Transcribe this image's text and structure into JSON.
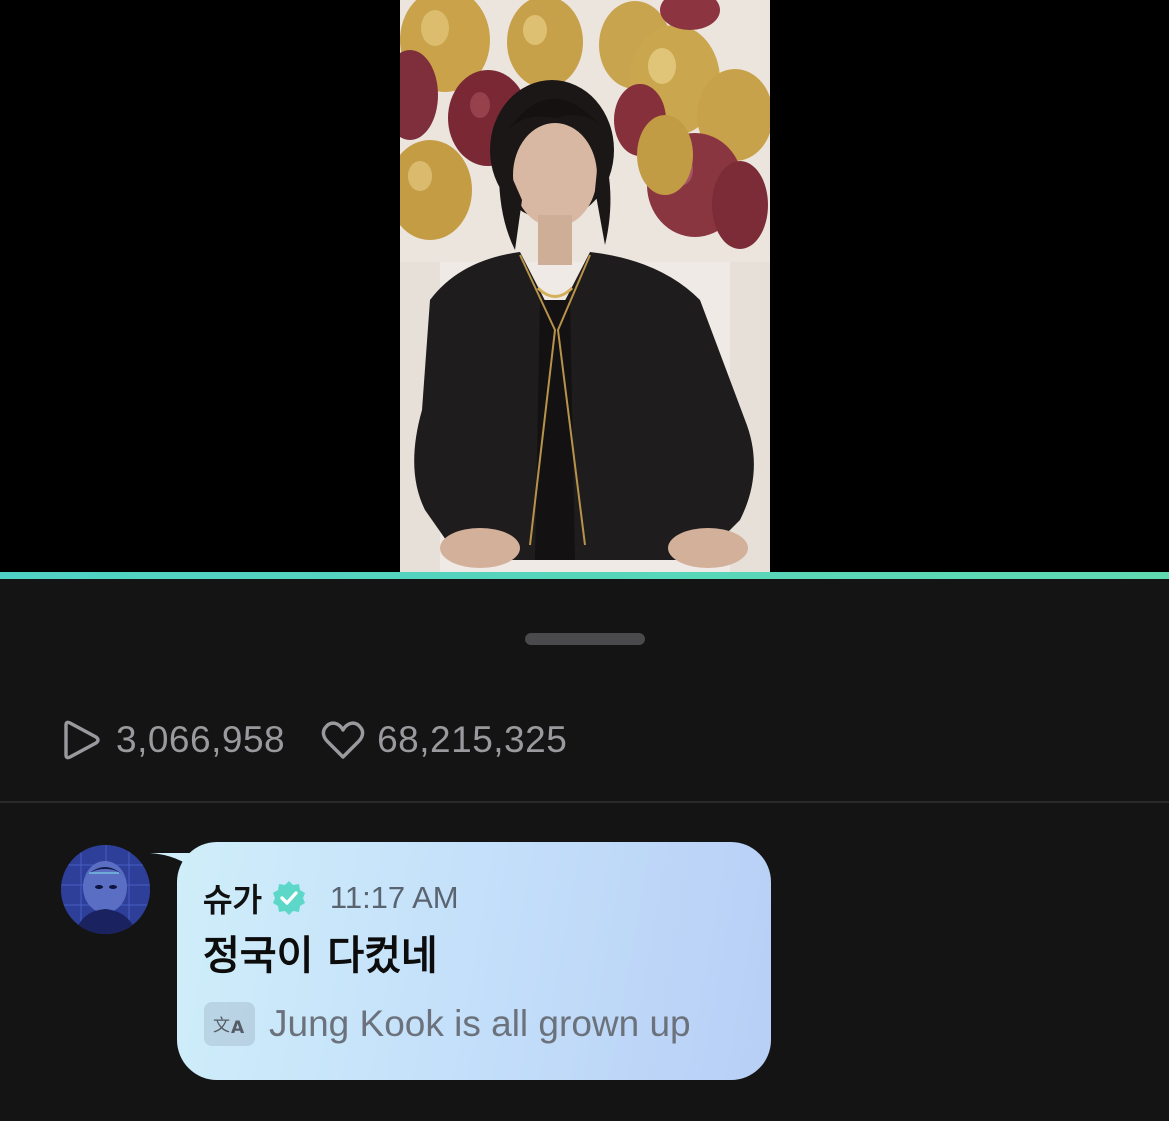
{
  "video": {
    "background": "#000000",
    "progress_color": "#4fd1c5",
    "progress": 1.0
  },
  "stats": {
    "plays": "3,066,958",
    "likes": "68,215,325",
    "play_icon": "play-icon",
    "like_icon": "heart-icon"
  },
  "comment": {
    "author": "슈가",
    "verified_icon": "verified-badge-icon",
    "time": "11:17 AM",
    "message": "정국이 다컸네",
    "translate_icon": "translate-icon",
    "translation": "Jung Kook is all grown up",
    "bubble_colors": [
      "#cfeef9",
      "#b8cff6"
    ],
    "verified_color": "#5dd8c8"
  }
}
